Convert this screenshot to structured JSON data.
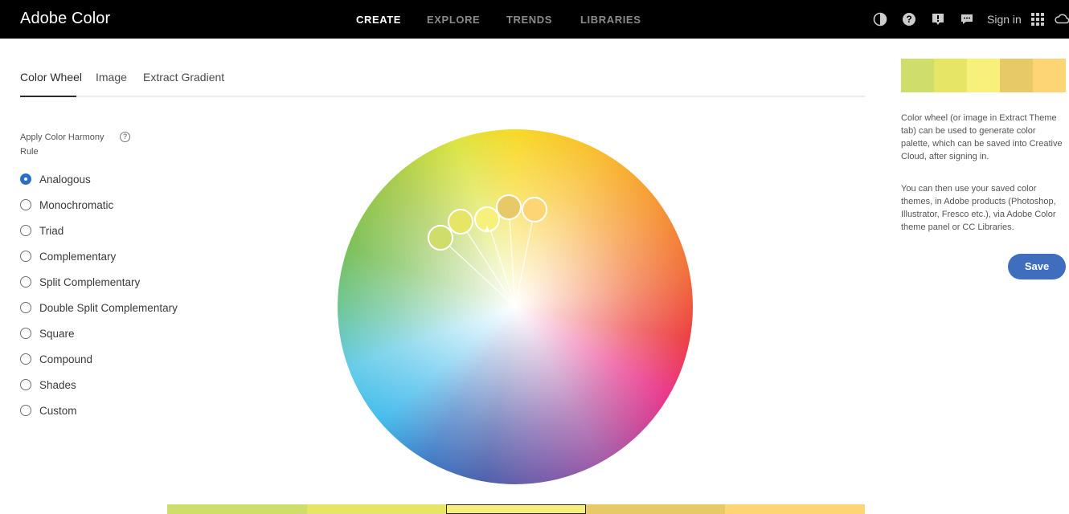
{
  "app": {
    "title": "Adobe Color"
  },
  "nav": {
    "items": [
      "CREATE",
      "EXPLORE",
      "TRENDS",
      "LIBRARIES"
    ],
    "active": "CREATE"
  },
  "header": {
    "sign_in": "Sign in"
  },
  "tabs": {
    "items": [
      "Color Wheel",
      "Image",
      "Extract Gradient"
    ],
    "active": "Color Wheel"
  },
  "harmony": {
    "title": "Apply Color Harmony Rule",
    "help": "?",
    "selected": "Analogous",
    "rules": [
      "Analogous",
      "Monochromatic",
      "Triad",
      "Complementary",
      "Split Complementary",
      "Double Split Complementary",
      "Square",
      "Compound",
      "Shades",
      "Custom"
    ]
  },
  "theme": {
    "swatches": [
      "#cfdd6a",
      "#e6e566",
      "#f7f07a",
      "#e7ca67",
      "#fdd574"
    ],
    "selected_index": 2
  },
  "info": {
    "para1": "Color wheel (or image in Extract Theme tab) can be used to generate color palette, which can be saved into Creative Cloud, after signing in.",
    "para2": "You can then use your saved color themes, in Adobe products (Photoshop, Illustrator, Fresco etc.), via Adobe Color theme panel or CC Libraries."
  },
  "actions": {
    "save": "Save"
  },
  "icons": [
    "color-blind-icon",
    "help-icon",
    "feedback-icon",
    "chat-icon",
    "apps-grid-icon",
    "creative-cloud-icon"
  ]
}
